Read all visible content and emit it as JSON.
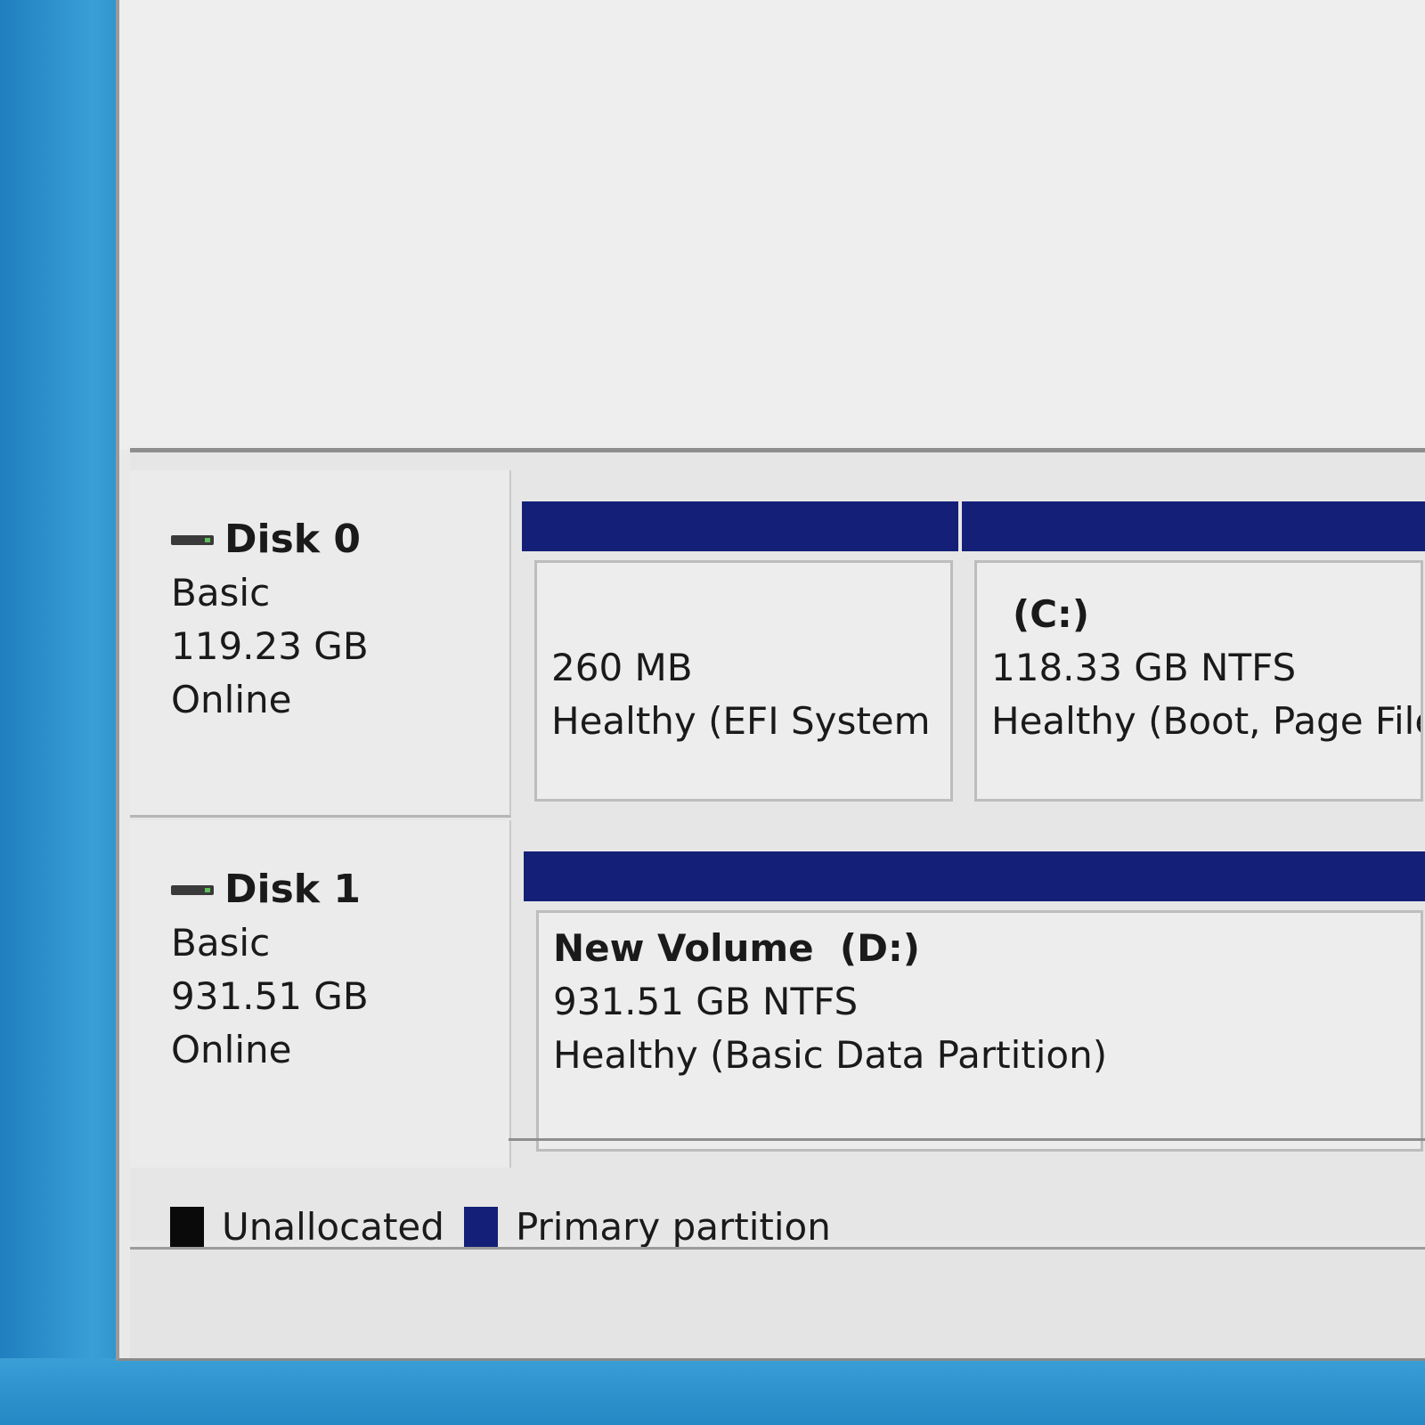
{
  "colors": {
    "primary_partition": "#142077",
    "unallocated": "#0a0a0a"
  },
  "disks": [
    {
      "name": "Disk 0",
      "type": "Basic",
      "size": "119.23 GB",
      "status": "Online",
      "partitions": [
        {
          "title": "",
          "size": "260 MB",
          "status": "Healthy (EFI System"
        },
        {
          "title": "(C:)",
          "size": "118.33 GB NTFS",
          "status": "Healthy (Boot, Page File"
        }
      ]
    },
    {
      "name": "Disk 1",
      "type": "Basic",
      "size": "931.51 GB",
      "status": "Online",
      "partitions": [
        {
          "title": "New Volume  (D:)",
          "size": "931.51 GB NTFS",
          "status": "Healthy (Basic Data Partition)"
        }
      ]
    }
  ],
  "legend": {
    "unallocated": "Unallocated",
    "primary": "Primary partition"
  }
}
